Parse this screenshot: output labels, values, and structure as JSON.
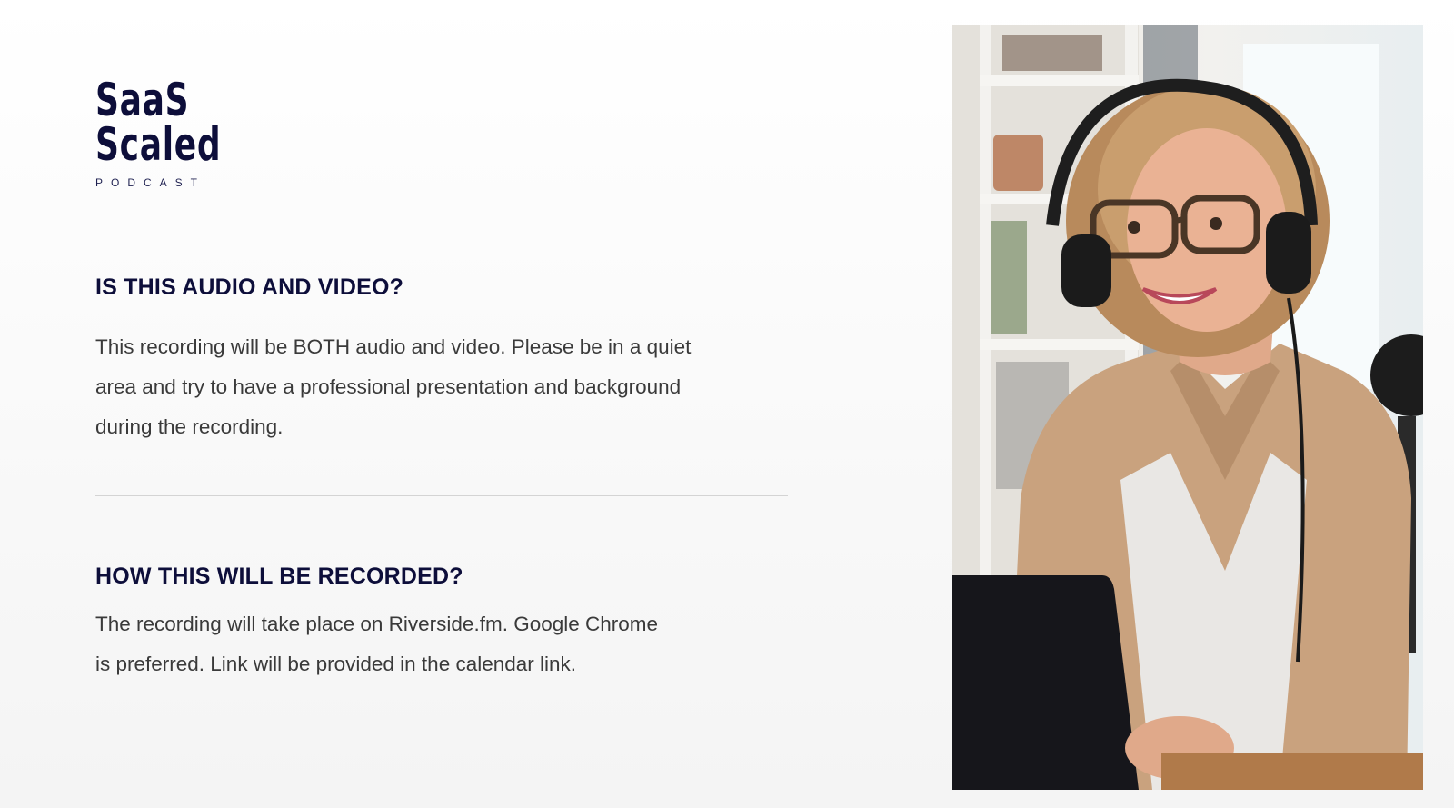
{
  "logo": {
    "line1": "SaaS",
    "line2": "Scaled",
    "sub": "PODCAST"
  },
  "sections": [
    {
      "heading": "IS THIS AUDIO AND VIDEO?",
      "lines": [
        "This recording will be BOTH audio and video. Please be in a quiet",
        "area and try to have a professional presentation and background",
        "during the recording."
      ]
    },
    {
      "heading": "HOW THIS WILL BE RECORDED?",
      "lines": [
        "The recording will take place on Riverside.fm. Google Chrome",
        "is preferred. Link will be provided in the calendar link."
      ]
    }
  ],
  "colors": {
    "heading": "#0d0e3a",
    "body_text": "#3a3a3a",
    "divider": "#d4d4d4"
  }
}
